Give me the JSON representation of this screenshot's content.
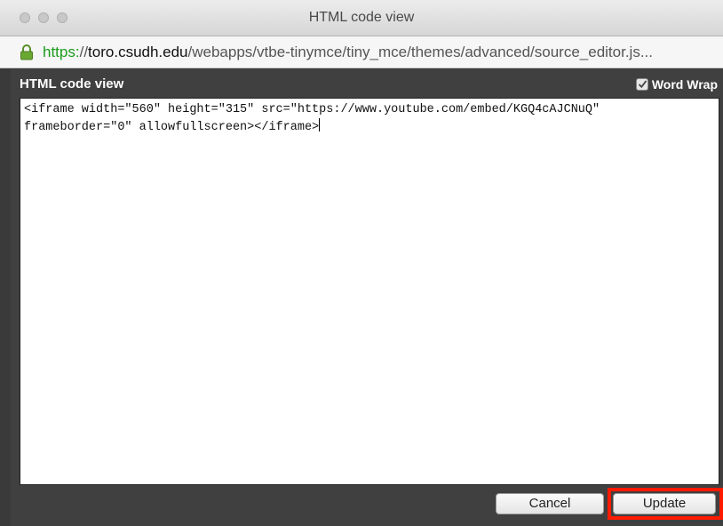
{
  "window": {
    "title": "HTML code view"
  },
  "urlbar": {
    "scheme": "https:",
    "host_prefix": "//",
    "host": "toro.csudh.edu",
    "path": "/webapps/vtbe-tinymce/tiny_mce/themes/advanced/source_editor.js..."
  },
  "dialog": {
    "title": "HTML code view",
    "word_wrap_label": "Word Wrap",
    "word_wrap_checked": true,
    "editor_content": "<iframe width=\"560\" height=\"315\" src=\"https://www.youtube.com/embed/KGQ4cAJCNuQ\"\nframeborder=\"0\" allowfullscreen></iframe>",
    "cancel_label": "Cancel",
    "update_label": "Update"
  },
  "colors": {
    "secure_scheme": "#1a9c1a",
    "highlight": "#ff1a00",
    "dialog_bg": "#404040"
  }
}
